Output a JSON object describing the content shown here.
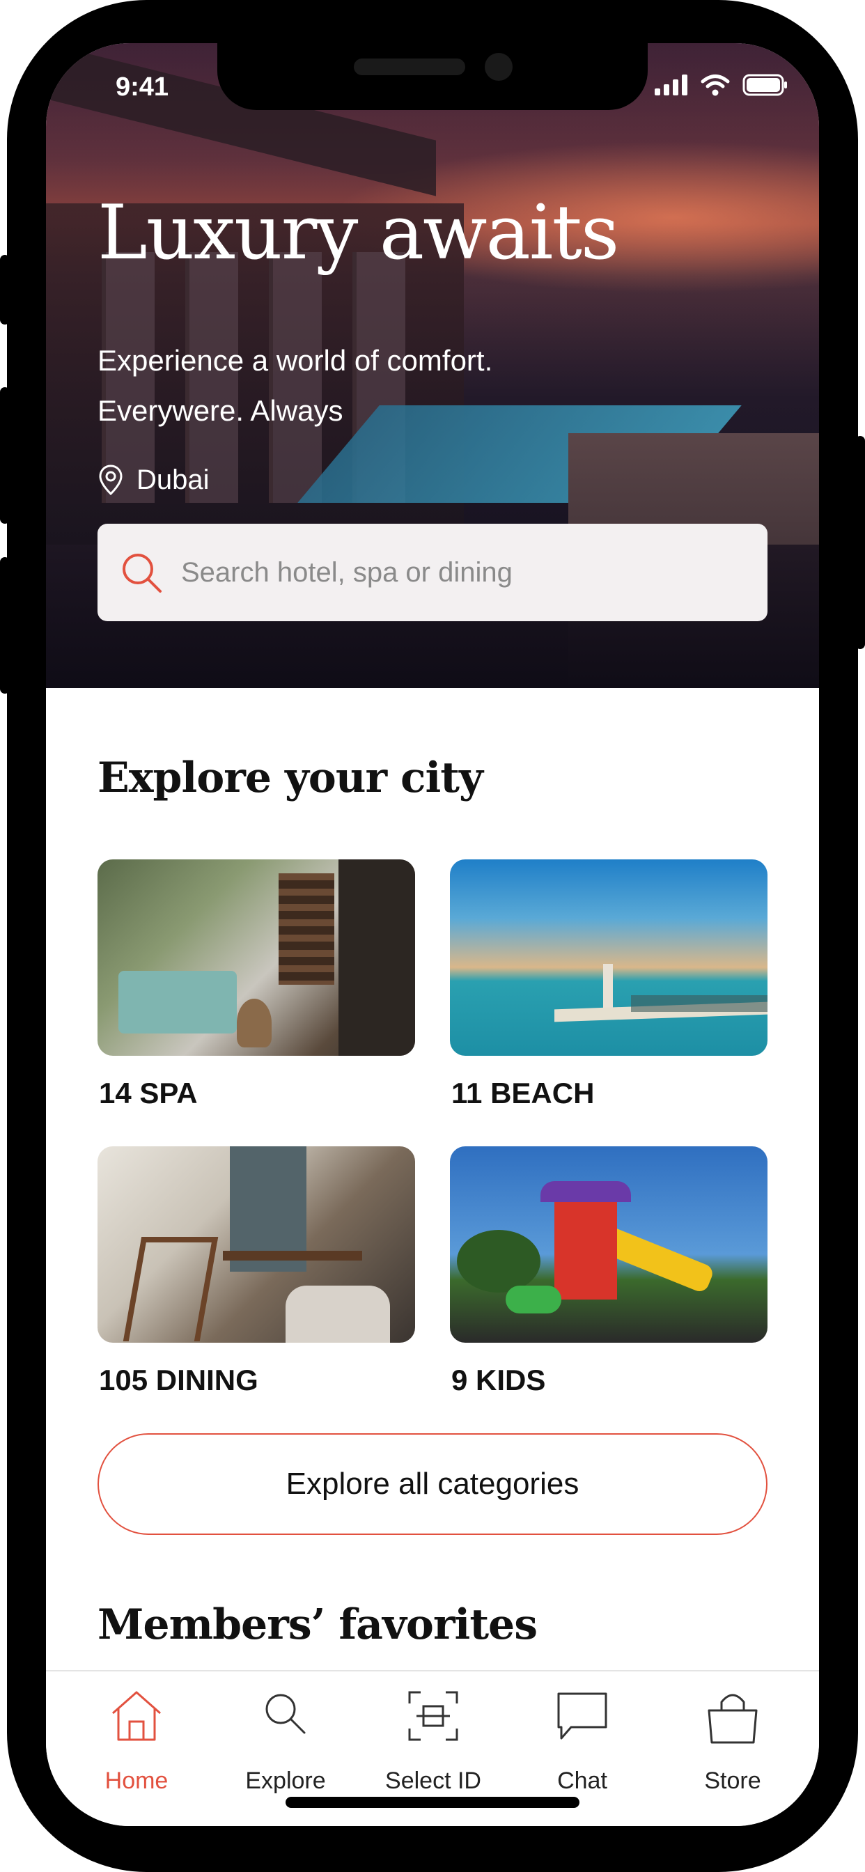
{
  "status_bar": {
    "time": "9:41"
  },
  "hero": {
    "title": "Luxury awaits",
    "subtitle_line1": "Experience a world of comfort.",
    "subtitle_line2": "Everywere. Always",
    "location": "Dubai",
    "search_placeholder": "Search hotel, spa or dining"
  },
  "explore": {
    "title": "Explore your city",
    "categories": [
      {
        "label": "14 SPA"
      },
      {
        "label": "11 BEACH"
      },
      {
        "label": "105 DINING"
      },
      {
        "label": "9 KIDS"
      }
    ],
    "cta_label": "Explore all categories"
  },
  "favorites": {
    "title": "Members’ favorites"
  },
  "tab_bar": {
    "items": [
      {
        "label": "Home",
        "icon": "home-icon",
        "active": true
      },
      {
        "label": "Explore",
        "icon": "search-icon",
        "active": false
      },
      {
        "label": "Select ID",
        "icon": "scan-icon",
        "active": false
      },
      {
        "label": "Chat",
        "icon": "chat-icon",
        "active": false
      },
      {
        "label": "Store",
        "icon": "bag-icon",
        "active": false
      }
    ]
  },
  "colors": {
    "accent": "#e2513f",
    "search_bg": "#f3f0f1",
    "text": "#111111"
  }
}
